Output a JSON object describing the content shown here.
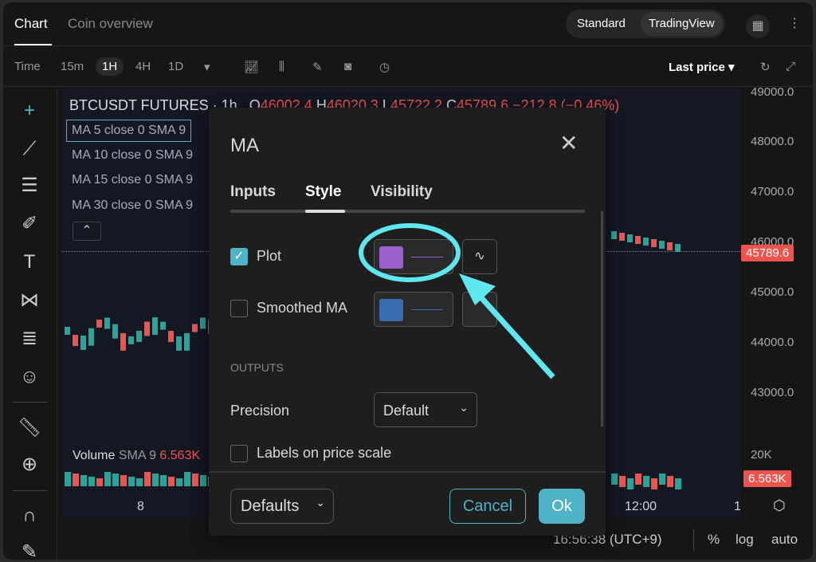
{
  "header": {
    "tabs": [
      "Chart",
      "Coin overview"
    ],
    "view_modes": [
      "Standard",
      "TradingView"
    ],
    "active_view": "TradingView"
  },
  "toolbar": {
    "time_label": "Time",
    "intervals": [
      "15m",
      "1H",
      "4H",
      "1D"
    ],
    "active_interval": "1H",
    "price_type": "Last price"
  },
  "chart": {
    "symbol": "BTCUSDT FUTURES · 1h",
    "ohlc": {
      "o_label": "O",
      "o": "46002.4",
      "h_label": "H",
      "h": "46020.3",
      "l_label": "L",
      "l": "45722.2",
      "c_label": "C",
      "c": "45789.6",
      "change": "−212.8 (−0.46%)"
    },
    "indicators": [
      "MA 5 close 0 SMA 9",
      "MA 10 close 0 SMA 9",
      "MA 15 close 0 SMA 9",
      "MA 30 close 0 SMA 9"
    ],
    "volume_legend": "Volume",
    "volume_sma": "SMA 9",
    "volume_value": "6.563K",
    "price_ticks": [
      "49000.0",
      "48000.0",
      "47000.0",
      "46000.0",
      "45000.0",
      "44000.0",
      "43000.0"
    ],
    "current_price": "45789.6",
    "volume_tick": "20K",
    "volume_badge": "6.563K",
    "time_ticks": [
      "8",
      "12:00",
      "1'"
    ],
    "footer": {
      "clock": "16:56:38 (UTC+9)",
      "percent": "%",
      "log": "log",
      "auto": "auto"
    },
    "colors": {
      "up": "#26a69a",
      "down": "#ef5350",
      "accent": "#4fb3c8",
      "highlight": "#5ee7ee"
    }
  },
  "dialog": {
    "title": "MA",
    "tabs": [
      "Inputs",
      "Style",
      "Visibility"
    ],
    "active_tab": "Style",
    "plot_label": "Plot",
    "plot_checked": true,
    "plot_color": "#9b5fd0",
    "smoothed_label": "Smoothed MA",
    "smoothed_checked": false,
    "smoothed_color": "#3a6ab0",
    "outputs_header": "OUTPUTS",
    "precision_label": "Precision",
    "precision_value": "Default",
    "labels_scale": "Labels on price scale",
    "defaults": "Defaults",
    "cancel": "Cancel",
    "ok": "Ok"
  }
}
